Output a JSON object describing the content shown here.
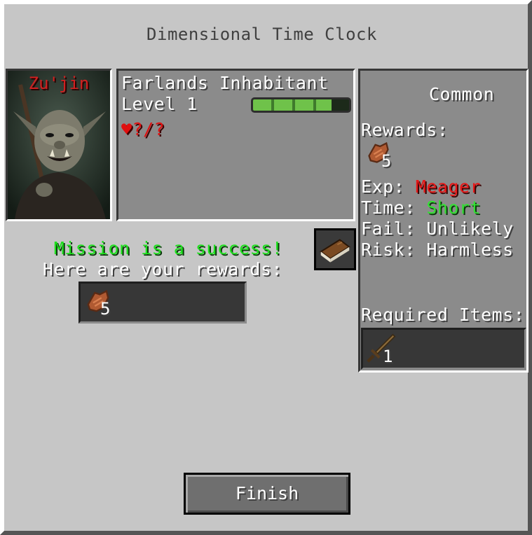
{
  "window": {
    "title": "Dimensional Time Clock"
  },
  "character": {
    "name": "Zu'jin",
    "type": "Farlands Inhabitant",
    "level": "Level 1",
    "health": "?/?",
    "xp_progress": 0.82
  },
  "mission": {
    "rarity": "Common",
    "rewards_label": "Rewards:",
    "reward_item": {
      "icon": "leather-icon",
      "count": "5"
    },
    "exp_label": "Exp:",
    "exp_value": "Meager",
    "time_label": "Time:",
    "time_value": "Short",
    "fail_label": "Fail:",
    "fail_value": "Unlikely",
    "risk_label": "Risk:",
    "risk_value": "Harmless",
    "required_label": "Required Items:",
    "required_item": {
      "icon": "wooden-sword-icon",
      "count": "1"
    }
  },
  "result": {
    "status": "Mission is a success!",
    "rewards_text": "Here are your rewards:",
    "reward_item": {
      "icon": "leather-icon",
      "count": "5"
    }
  },
  "buttons": {
    "finish": "Finish",
    "book_icon": "book-icon"
  },
  "colors": {
    "success": "#1ee01e",
    "exp_value": "#e81818",
    "time_value": "#33e033",
    "name": "#d22020"
  }
}
